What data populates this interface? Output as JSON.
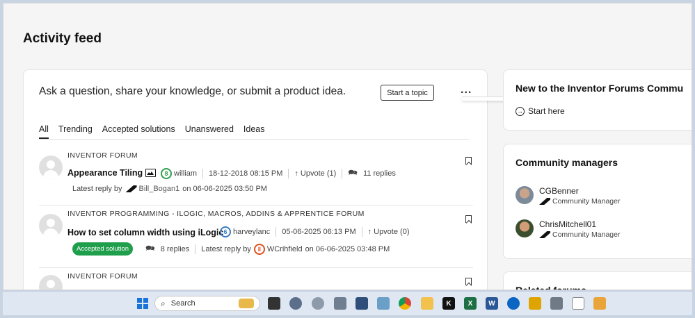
{
  "page": {
    "title": "Activity feed"
  },
  "composer": {
    "prompt": "Ask a question, share your knowledge, or submit a product idea.",
    "start_topic": "Start a topic",
    "more": "..."
  },
  "tabs": [
    "All",
    "Trending",
    "Accepted solutions",
    "Unanswered",
    "Ideas"
  ],
  "posts": [
    {
      "forum": "INVENTOR FORUM",
      "title": "Appearance Tiling",
      "author": "william",
      "author_rank": "8",
      "date": "18-12-2018 08:15 PM",
      "upvote": "Upvote (1)",
      "replies": "11 replies",
      "latest_prefix": "Latest reply by",
      "latest_user": "Bill_Bogan1",
      "latest_date": "on 06-06-2025 03:50 PM"
    },
    {
      "forum": "INVENTOR PROGRAMMING - ILOGIC, MACROS, ADDINS & APPRENTICE FORUM",
      "title": "How to set column width using iLogic",
      "author": "harveylanc",
      "author_rank": "6",
      "date": "05-06-2025 06:13 PM",
      "upvote": "Upvote (0)",
      "badge": "Accepted solution",
      "replies": "8 replies",
      "latest_prefix": "Latest reply by",
      "latest_user": "WCrihfield",
      "latest_date": "on 06-06-2025 03:48 PM"
    },
    {
      "forum": "INVENTOR FORUM"
    }
  ],
  "sidebar": {
    "welcome_title": "New to the Inventor Forums Commu",
    "start_here": "Start here",
    "managers_title": "Community managers",
    "managers": [
      {
        "name": "CGBenner",
        "role": "Community Manager"
      },
      {
        "name": "ChrisMitchell01",
        "role": "Community Manager"
      }
    ],
    "related_title": "Related forums"
  },
  "taskbar": {
    "search_placeholder": "Search"
  },
  "colors": {
    "accepted": "#1f9e4b",
    "rank_green": "#2e9e4d",
    "rank_blue": "#3a7bbf",
    "rank_orange": "#e0501d"
  }
}
